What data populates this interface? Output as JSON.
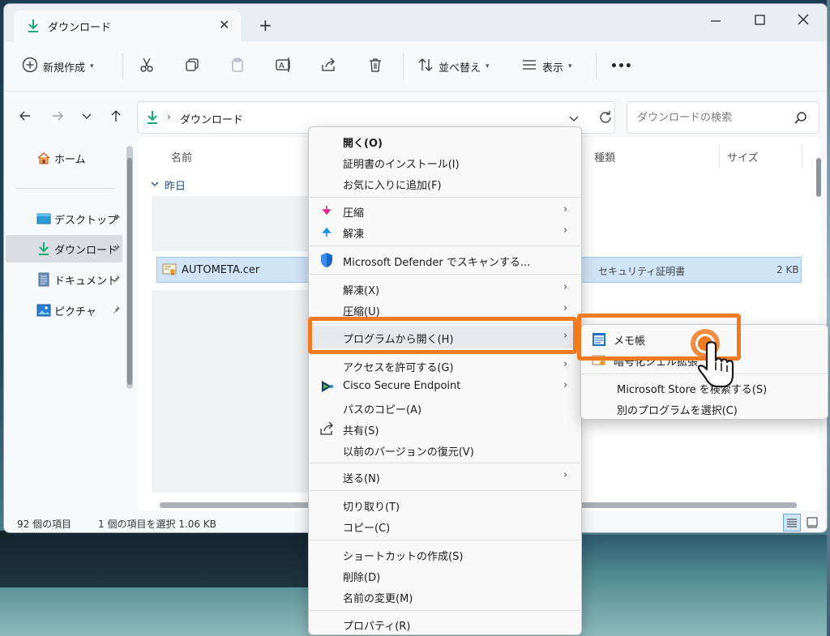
{
  "window": {
    "tab_title": "ダウンロード",
    "new_tab": "+"
  },
  "toolbar": {
    "new_label": "新規作成",
    "sort_label": "並べ替え",
    "view_label": "表示",
    "more": "•••"
  },
  "address": {
    "path": "ダウンロード",
    "search_placeholder": "ダウンロードの検索"
  },
  "sidebar": {
    "items": [
      {
        "label": "ホーム",
        "icon": "home-icon"
      },
      {
        "label": "デスクトップ",
        "icon": "desktop-icon"
      },
      {
        "label": "ダウンロード",
        "icon": "download-icon"
      },
      {
        "label": "ドキュメント",
        "icon": "document-icon"
      },
      {
        "label": "ピクチャ",
        "icon": "picture-icon"
      }
    ]
  },
  "filelist": {
    "columns": {
      "name": "名前",
      "type": "種類",
      "size": "サイズ"
    },
    "group": "昨日",
    "file": {
      "name": "AUTOMETA.cer",
      "type": "セキュリティ証明書",
      "size": "2 KB"
    }
  },
  "status": {
    "count": "92 個の項目",
    "selected": "1 個の項目を選択  1.06 KB"
  },
  "context_menu": {
    "items": [
      "開く(O)",
      "証明書のインストール(I)",
      "お気に入りに追加(F)",
      "圧縮",
      "解凍",
      "Microsoft Defender でスキャンする...",
      "解凍(X)",
      "圧縮(U)",
      "プログラムから開く(H)",
      "アクセスを許可する(G)",
      "Cisco Secure Endpoint",
      "パスのコピー(A)",
      "共有(S)",
      "以前のバージョンの復元(V)",
      "送る(N)",
      "切り取り(T)",
      "コピー(C)",
      "ショートカットの作成(S)",
      "削除(D)",
      "名前の変更(M)",
      "プロパティ(R)"
    ]
  },
  "submenu": {
    "items": [
      "メモ帳",
      "暗号化シェル拡張",
      "Microsoft Store を検索する(S)",
      "別のプログラムを選択(C)"
    ]
  },
  "colors": {
    "accent": "#0067c0",
    "highlight": "#ef7a22",
    "selection": "#cfe4f7",
    "download_green": "#19a974"
  }
}
